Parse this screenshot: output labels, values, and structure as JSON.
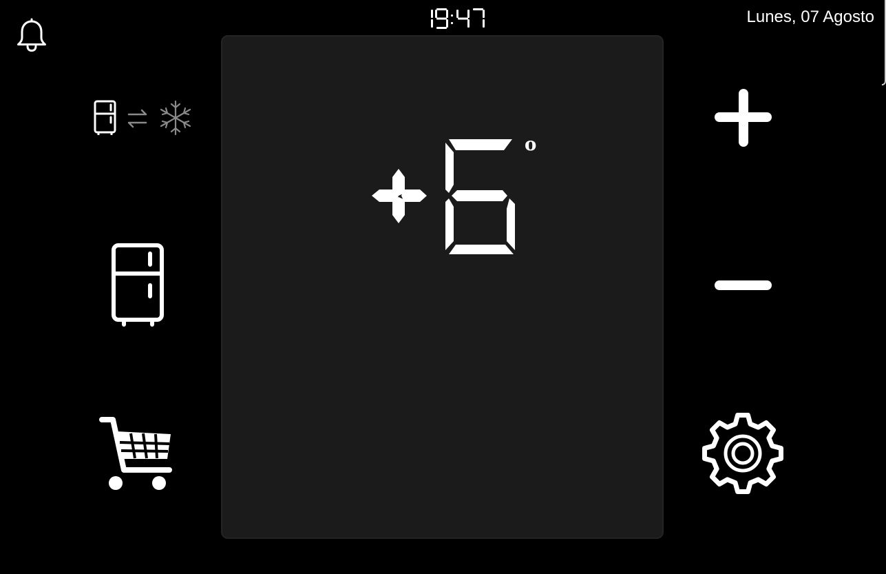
{
  "header": {
    "time": "19:47",
    "date": "Lunes, 07 Agosto"
  },
  "icons": {
    "notifications": "bell-icon",
    "mode_toggle": [
      "fridge-small-icon",
      "swap-arrows-icon",
      "snowflake-icon"
    ],
    "fridge": "fridge-icon",
    "shopping": "shopping-cart-icon",
    "increase": "plus-icon",
    "decrease": "minus-icon",
    "settings": "gear-icon"
  },
  "temperature": {
    "sign": "+",
    "value": "6",
    "unit": "°"
  },
  "colors": {
    "background": "#000000",
    "panel": "#1b1b1b",
    "foreground": "#ffffff",
    "inactive": "#8a8a8a"
  }
}
